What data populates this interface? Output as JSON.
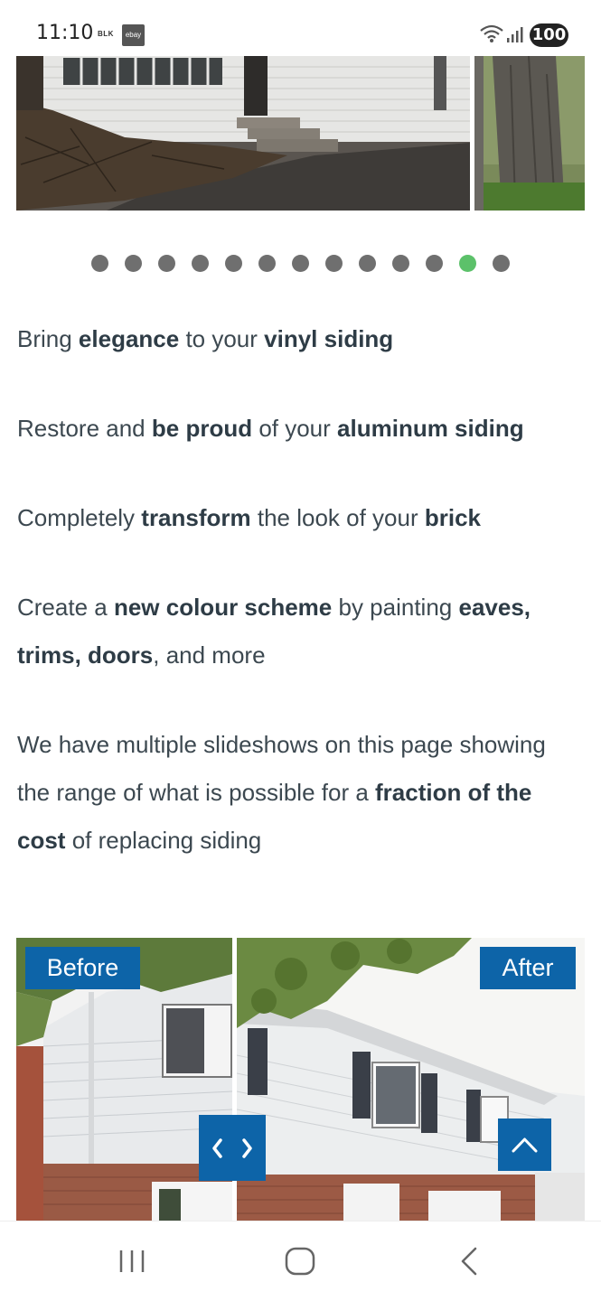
{
  "status_bar": {
    "time": "11:10",
    "app_icon_1": "BLK",
    "app_icon_2": "ebay",
    "battery": "100"
  },
  "carousel": {
    "dot_count": 13,
    "active_index": 11,
    "active_color": "#5cc16a",
    "dot_color": "#6f6f6f"
  },
  "content": {
    "paragraphs": [
      {
        "segments": [
          {
            "text": "Bring ",
            "bold": false
          },
          {
            "text": "elegance",
            "bold": true
          },
          {
            "text": " to your ",
            "bold": false
          },
          {
            "text": "vinyl siding",
            "bold": true
          }
        ]
      },
      {
        "segments": [
          {
            "text": "Restore and ",
            "bold": false
          },
          {
            "text": "be proud",
            "bold": true
          },
          {
            "text": " of your ",
            "bold": false
          },
          {
            "text": "aluminum siding",
            "bold": true
          }
        ]
      },
      {
        "segments": [
          {
            "text": "Completely ",
            "bold": false
          },
          {
            "text": "transform",
            "bold": true
          },
          {
            "text": " the look of your ",
            "bold": false
          },
          {
            "text": "brick",
            "bold": true
          }
        ]
      },
      {
        "segments": [
          {
            "text": "Create a ",
            "bold": false
          },
          {
            "text": "new colour scheme",
            "bold": true
          },
          {
            "text": " by painting ",
            "bold": false
          },
          {
            "text": "eaves, trims, doors",
            "bold": true
          },
          {
            "text": ", and more",
            "bold": false
          }
        ]
      },
      {
        "segments": [
          {
            "text": "We have multiple slideshows on this page showing the range of what is possible for a ",
            "bold": false
          },
          {
            "text": "fraction of the cost",
            "bold": true
          },
          {
            "text": " of replacing siding",
            "bold": false
          }
        ]
      }
    ]
  },
  "before_after": {
    "before_label": "Before",
    "after_label": "After",
    "handle_icon": "chevron-left-right-icon",
    "accent": "#0d64a8"
  },
  "nav": {
    "recent_icon": "recent-apps-icon",
    "home_icon": "home-icon",
    "back_icon": "back-icon"
  }
}
